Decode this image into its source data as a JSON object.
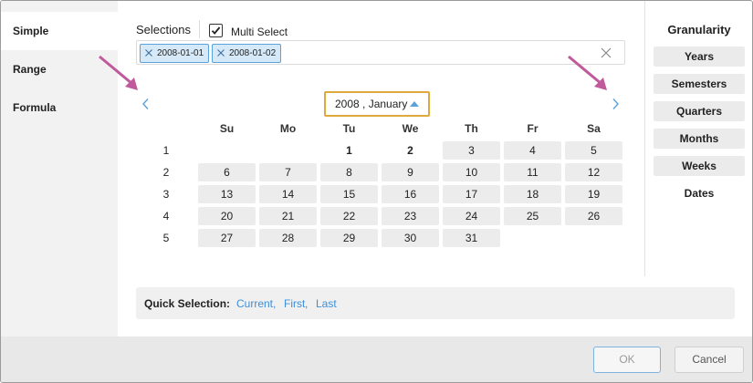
{
  "sidebar": {
    "items": [
      {
        "label": "Simple",
        "active": true
      },
      {
        "label": "Range",
        "active": false
      },
      {
        "label": "Formula",
        "active": false
      }
    ]
  },
  "selections": {
    "label": "Selections",
    "multi_select_label": "Multi Select",
    "multi_select_checked": true,
    "chips": [
      "2008-01-01",
      "2008-01-02"
    ]
  },
  "calendar": {
    "month_label": "2008 , January",
    "day_headers": [
      "Su",
      "Mo",
      "Tu",
      "We",
      "Th",
      "Fr",
      "Sa"
    ],
    "weeks": [
      {
        "num": "1",
        "days": [
          "",
          "",
          "1",
          "2",
          "3",
          "4",
          "5"
        ]
      },
      {
        "num": "2",
        "days": [
          "6",
          "7",
          "8",
          "9",
          "10",
          "11",
          "12"
        ]
      },
      {
        "num": "3",
        "days": [
          "13",
          "14",
          "15",
          "16",
          "17",
          "18",
          "19"
        ]
      },
      {
        "num": "4",
        "days": [
          "20",
          "21",
          "22",
          "23",
          "24",
          "25",
          "26"
        ]
      },
      {
        "num": "5",
        "days": [
          "27",
          "28",
          "29",
          "30",
          "31",
          "",
          ""
        ]
      }
    ],
    "selected_days": [
      "1",
      "2"
    ]
  },
  "quick_selection": {
    "label": "Quick Selection:",
    "links": [
      "Current",
      "First",
      "Last"
    ]
  },
  "granularity": {
    "title": "Granularity",
    "options": [
      {
        "label": "Years",
        "active": false
      },
      {
        "label": "Semesters",
        "active": false
      },
      {
        "label": "Quarters",
        "active": false
      },
      {
        "label": "Months",
        "active": false
      },
      {
        "label": "Weeks",
        "active": false
      },
      {
        "label": "Dates",
        "active": true
      }
    ]
  },
  "footer": {
    "ok_label": "OK",
    "cancel_label": "Cancel"
  },
  "colors": {
    "accent": "#5aa2dc",
    "highlight_border": "#e0a93b",
    "annotation_arrow": "#c05a9c",
    "link": "#3d8fd6"
  }
}
